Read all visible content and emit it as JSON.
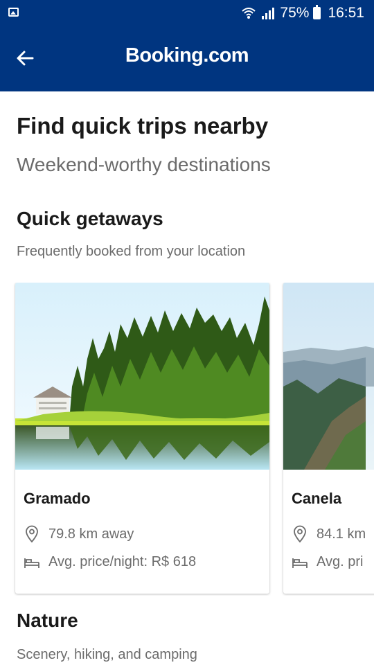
{
  "status_bar": {
    "battery_percent": "75%",
    "time": "16:51",
    "icons": [
      "image-notification-icon",
      "wifi-icon",
      "signal-icon",
      "battery-icon"
    ]
  },
  "app_bar": {
    "back_icon": "arrow-left-icon",
    "brand": "Booking.com",
    "background": "#003580"
  },
  "intro": {
    "title": "Find quick trips nearby",
    "subtitle": "Weekend-worthy destinations"
  },
  "quick_getaways": {
    "title": "Quick getaways",
    "subtitle": "Frequently booked from your location",
    "cards": [
      {
        "name": "Gramado",
        "distance": "79.8 km away",
        "price": "Avg. price/night: R$ 618",
        "photo": "lake-with-forest"
      },
      {
        "name": "Canela",
        "distance": "84.1 km",
        "price": "Avg. pri",
        "photo": "mountain-valley"
      }
    ]
  },
  "nature": {
    "title": "Nature",
    "subtitle": "Scenery, hiking, and camping"
  }
}
